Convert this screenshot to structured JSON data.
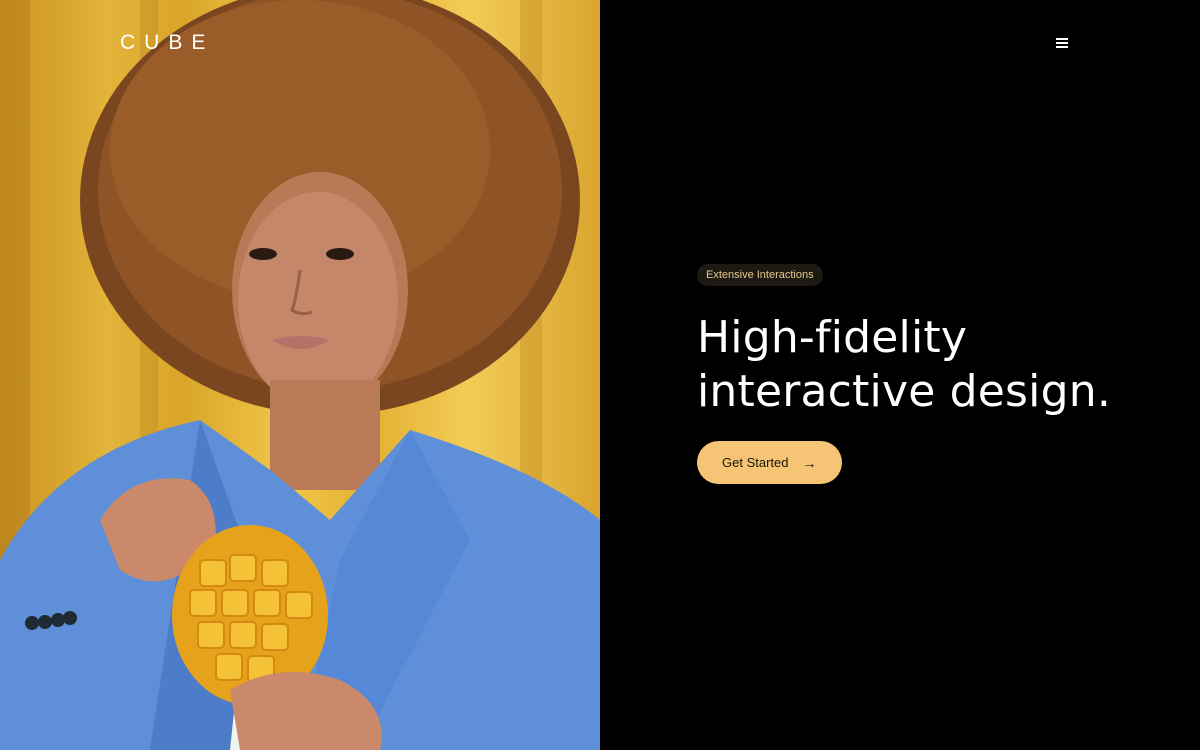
{
  "brand": {
    "logo_text": "CUBE"
  },
  "nav": {
    "menu_icon": "hamburger-menu-icon"
  },
  "hero": {
    "tag": "Extensive Interactions",
    "headline_line1": "High-fidelity",
    "headline_line2": "interactive design.",
    "cta_label": "Get Started",
    "cta_icon": "arrow-right-icon",
    "cta_arrow_glyph": "→"
  },
  "colors": {
    "background": "#000000",
    "accent": "#f5c575",
    "tag_text": "#e6c98c",
    "tag_bg": "#1d1a14",
    "text": "#ffffff"
  }
}
